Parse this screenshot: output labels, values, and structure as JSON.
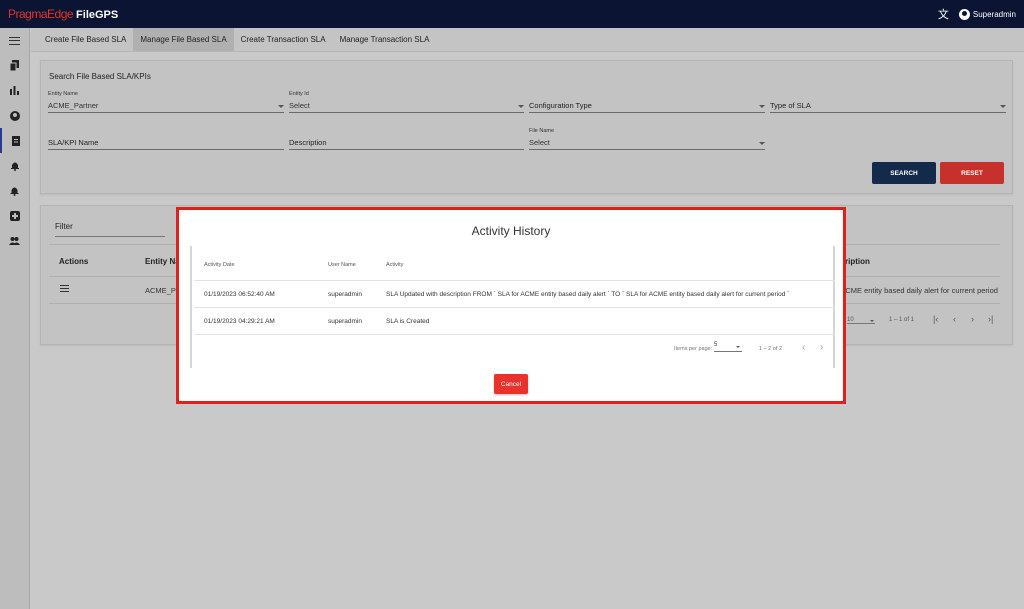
{
  "app": {
    "brand": "PragmaEdge",
    "name": "FileGPS"
  },
  "topbar": {
    "translate_icon": "translate-icon",
    "user": "Superadmin"
  },
  "sidebar": {
    "items": [
      {
        "icon": "menu-icon"
      },
      {
        "icon": "file-copy-icon"
      },
      {
        "icon": "bar-chart-icon"
      },
      {
        "icon": "account-circle-icon"
      },
      {
        "icon": "document-icon",
        "active": true
      },
      {
        "icon": "notification-icon"
      },
      {
        "icon": "alert-bell-icon"
      },
      {
        "icon": "support-icon"
      },
      {
        "icon": "people-icon"
      }
    ]
  },
  "tabs": [
    {
      "label": "Create File Based SLA"
    },
    {
      "label": "Manage File Based SLA",
      "active": true
    },
    {
      "label": "Create Transaction SLA"
    },
    {
      "label": "Manage Transaction SLA"
    }
  ],
  "search": {
    "title": "Search File Based SLA/KPIs",
    "entity_name_label": "Entity Name",
    "entity_name_value": "ACME_Partner",
    "entity_id_label": "Entity Id",
    "entity_id_value": "Select",
    "config_type_placeholder": "Configuration Type",
    "sla_type_placeholder": "Type of SLA",
    "kpi_name_placeholder": "SLA/KPI Name",
    "description_placeholder": "Description",
    "file_name_label": "File Name",
    "file_name_value": "Select",
    "search_button": "SEARCH",
    "reset_button": "RESET"
  },
  "results": {
    "filter_label": "Filter",
    "columns": {
      "actions": "Actions",
      "entity_name": "Entity Nam",
      "description": "ription"
    },
    "row": {
      "entity_name": "ACME_Par",
      "description": "or ACME entity based daily alert for current period"
    },
    "pager": {
      "size": "10",
      "range": "1 – 1 of 1"
    }
  },
  "modal": {
    "title": "Activity History",
    "columns": {
      "date": "Activity Date",
      "user": "User Name",
      "activity": "Activity"
    },
    "rows": [
      {
        "date": "01/19/2023 06:52:40 AM",
        "user": "superadmin",
        "activity": "SLA Updated with description FROM ` SLA for ACME entity based daily alert ` TO ` SLA for ACME entity based daily alert for current period `"
      },
      {
        "date": "01/19/2023 04:29:21 AM",
        "user": "superadmin",
        "activity": "SLA is Created"
      }
    ],
    "pager": {
      "label": "Items per page:",
      "size": "5",
      "range": "1 – 2 of 2"
    },
    "cancel_button": "Cancel"
  },
  "colors": {
    "topbar": "#0b1433",
    "accent_red": "#e1201e",
    "search_button": "#142a4b",
    "reset_button": "#c6312b"
  }
}
